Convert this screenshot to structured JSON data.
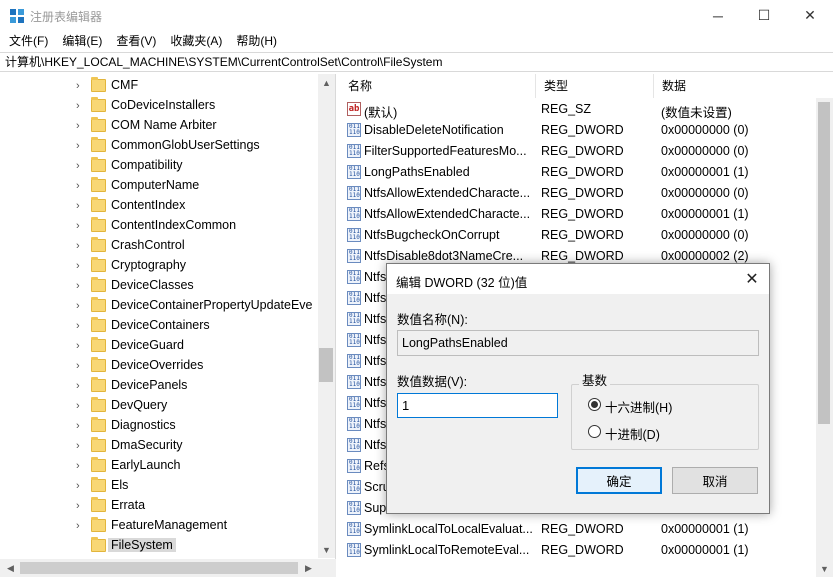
{
  "window": {
    "title": "注册表编辑器",
    "minimize_glyph": "─",
    "maximize_glyph": "☐",
    "close_glyph": "✕"
  },
  "menu": [
    "文件(F)",
    "编辑(E)",
    "查看(V)",
    "收藏夹(A)",
    "帮助(H)"
  ],
  "address": "计算机\\HKEY_LOCAL_MACHINE\\SYSTEM\\CurrentControlSet\\Control\\FileSystem",
  "tree": {
    "items": [
      {
        "label": "CMF"
      },
      {
        "label": "CoDeviceInstallers"
      },
      {
        "label": "COM Name Arbiter"
      },
      {
        "label": "CommonGlobUserSettings"
      },
      {
        "label": "Compatibility"
      },
      {
        "label": "ComputerName"
      },
      {
        "label": "ContentIndex"
      },
      {
        "label": "ContentIndexCommon"
      },
      {
        "label": "CrashControl"
      },
      {
        "label": "Cryptography"
      },
      {
        "label": "DeviceClasses"
      },
      {
        "label": "DeviceContainerPropertyUpdateEve"
      },
      {
        "label": "DeviceContainers"
      },
      {
        "label": "DeviceGuard"
      },
      {
        "label": "DeviceOverrides"
      },
      {
        "label": "DevicePanels"
      },
      {
        "label": "DevQuery"
      },
      {
        "label": "Diagnostics"
      },
      {
        "label": "DmaSecurity"
      },
      {
        "label": "EarlyLaunch"
      },
      {
        "label": "Els"
      },
      {
        "label": "Errata"
      },
      {
        "label": "FeatureManagement"
      },
      {
        "label": "FileSystem"
      }
    ],
    "selected": "FileSystem"
  },
  "columns": {
    "name": "名称",
    "type": "类型",
    "data": "数据"
  },
  "values": [
    {
      "name": "(默认)",
      "type": "REG_SZ",
      "data": "(数值未设置)",
      "kind": "string"
    },
    {
      "name": "DisableDeleteNotification",
      "type": "REG_DWORD",
      "data": "0x00000000 (0)",
      "kind": "dword"
    },
    {
      "name": "FilterSupportedFeaturesMo...",
      "type": "REG_DWORD",
      "data": "0x00000000 (0)",
      "kind": "dword"
    },
    {
      "name": "LongPathsEnabled",
      "type": "REG_DWORD",
      "data": "0x00000001 (1)",
      "kind": "dword"
    },
    {
      "name": "NtfsAllowExtendedCharacte...",
      "type": "REG_DWORD",
      "data": "0x00000000 (0)",
      "kind": "dword"
    },
    {
      "name": "NtfsAllowExtendedCharacte...",
      "type": "REG_DWORD",
      "data": "0x00000001 (1)",
      "kind": "dword"
    },
    {
      "name": "NtfsBugcheckOnCorrupt",
      "type": "REG_DWORD",
      "data": "0x00000000 (0)",
      "kind": "dword"
    },
    {
      "name": "NtfsDisable8dot3NameCre...",
      "type": "REG_DWORD",
      "data": "0x00000002 (2)",
      "kind": "dword"
    },
    {
      "name": "Ntfs",
      "type": "",
      "data": "",
      "kind": "dword"
    },
    {
      "name": "Ntfs",
      "type": "",
      "data": "",
      "kind": "dword"
    },
    {
      "name": "Ntfs",
      "type": "",
      "data": "",
      "kind": "dword"
    },
    {
      "name": "Ntfs",
      "type": "",
      "data": "",
      "kind": "dword"
    },
    {
      "name": "Ntfs",
      "type": "",
      "data": "",
      "kind": "dword"
    },
    {
      "name": "Ntfs",
      "type": "",
      "data": "",
      "kind": "dword"
    },
    {
      "name": "Ntfs",
      "type": "",
      "data": "",
      "kind": "dword"
    },
    {
      "name": "Ntfs",
      "type": "",
      "data": "",
      "kind": "dword"
    },
    {
      "name": "Ntfs",
      "type": "",
      "data": "",
      "kind": "dword"
    },
    {
      "name": "Refs",
      "type": "",
      "data": "",
      "kind": "dword"
    },
    {
      "name": "Scru",
      "type": "",
      "data": "",
      "kind": "dword"
    },
    {
      "name": "Sup",
      "type": "",
      "data": "",
      "kind": "dword"
    },
    {
      "name": "SymlinkLocalToLocalEvaluat...",
      "type": "REG_DWORD",
      "data": "0x00000001 (1)",
      "kind": "dword"
    },
    {
      "name": "SymlinkLocalToRemoteEval...",
      "type": "REG_DWORD",
      "data": "0x00000001 (1)",
      "kind": "dword"
    }
  ],
  "dialog": {
    "title": "编辑 DWORD (32 位)值",
    "close_glyph": "✕",
    "name_label": "数值名称(N):",
    "name_value": "LongPathsEnabled",
    "data_label": "数值数据(V):",
    "data_value": "1",
    "radix_label": "基数",
    "radix_hex": "十六进制(H)",
    "radix_dec": "十进制(D)",
    "radix_selected": "hex",
    "ok": "确定",
    "cancel": "取消"
  },
  "icons": {
    "app": "registry-editor-icon",
    "folder": "folder-icon",
    "dword": "binary-value-icon",
    "string": "string-value-icon"
  }
}
